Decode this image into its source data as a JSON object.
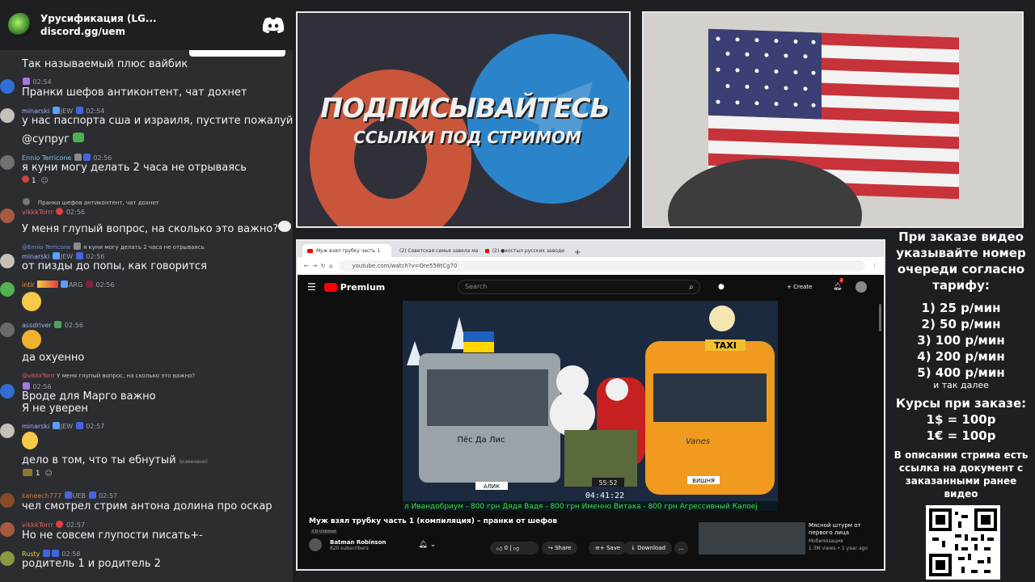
{
  "server": {
    "name": "Урусификация (LG...",
    "invite": "discord.gg/uem"
  },
  "messages": [
    {
      "id": "m1",
      "text": "Так называемый плюс вайбик"
    },
    {
      "id": "m2",
      "time": "02:54",
      "text": "Пранки шефов антиконтент, чат дохнет"
    },
    {
      "id": "m3",
      "user": "minarski",
      "tag": "JEW",
      "time": "02:54",
      "text": "у нас паспорта сша и израиля, пустите пожалуйста",
      "text2": "@супруг"
    },
    {
      "id": "m4",
      "user": "Ennio Terricone",
      "time": "02:56",
      "text": "я куни могу делать 2 часа не отрываясь",
      "reaction_count": "1"
    },
    {
      "id": "m5",
      "reply": "Пранки шефов антиконтент, чат дохнет",
      "user": "vikkkTorrr",
      "time": "02:56",
      "text": "У меня глупый вопрос, на сколько это важно?"
    },
    {
      "id": "m6",
      "reply_user": "@Ennio Terricone",
      "reply": "я куни могу делать 2 часа не отрываясь",
      "user": "minarski",
      "tag": "JEW",
      "time": "02:56",
      "text": "от пизды до попы, как говорится"
    },
    {
      "id": "m7",
      "user": "intir",
      "tag": "ARG",
      "time": "02:56"
    },
    {
      "id": "m8",
      "user": "assdriver",
      "time": "02:56",
      "text": "да охуенно"
    },
    {
      "id": "m9",
      "reply_user": "@vikkkTorrr",
      "reply": "У меня глупый вопрос, на сколько это важно?",
      "time": "02:56",
      "text": "Вроде для Марго важно",
      "text2": "Я не уверен"
    },
    {
      "id": "m10",
      "user": "minarski",
      "tag": "JEW",
      "time": "02:57",
      "text": "дело в том, что ты ебнутый",
      "edited": "(изменено)",
      "reaction_count": "1"
    },
    {
      "id": "m11",
      "user": "kaneech777",
      "tag": "UEB",
      "time": "02:57",
      "text": "чел смотрел стрим антона долина про оскар"
    },
    {
      "id": "m12",
      "user": "vikkkTorrr",
      "time": "02:57",
      "text": "Но не совсем глупости писать+-"
    },
    {
      "id": "m13",
      "user": "Rusty",
      "time": "02:58",
      "text": "родитель 1 и родитель 2"
    }
  ],
  "banner": {
    "title": "ПОДПИСЫВАЙТЕСЬ",
    "subtitle": "ССЫЛКИ ПОД СТРИМОМ"
  },
  "browser": {
    "tabs": [
      {
        "label": "Муж взял трубку часть 1"
      },
      {
        "label": "(2) Советская семья завела ма"
      },
      {
        "label": "(2) ●костыл русских заводи"
      }
    ],
    "url": "youtube.com/watch?v=Ore558tCg70",
    "brand": "Premium",
    "search_placeholder": "Search",
    "create_label": "Create",
    "notif_count": "2",
    "video": {
      "flag_sign": "TAXI",
      "banner_left": "Пёс Да Лис",
      "plate_left": "АЛИК",
      "plate_right": "ВИШНЯ",
      "timer_top": "55:52",
      "timer": "04:41:22",
      "ticker": "л Ивандобриум - 800 грн   Дядя Вадя - 800 грн   Именно Витаха - 800 грн   Агрессивный Калоеj",
      "bus_brand": "Vanes"
    },
    "video_title": "Муж взял трубку часть 1 (компиляция) – пранки от шефов",
    "unlisted": "CD Unlisted",
    "channel": {
      "name": "Batman Robinson",
      "subs": "820 subscribers"
    },
    "actions": {
      "likes": "0",
      "share": "Share",
      "save": "Save",
      "download": "Download"
    },
    "side_video": {
      "title": "Мясной штурм от первого лица",
      "channel": "Мобилизация",
      "views": "1.3M views • 1 year ago"
    }
  },
  "info": {
    "head": "При заказе видео указывайте номер очереди согласно тарифу:",
    "tariffs": [
      "1) 25 р/мин",
      "2) 50 р/мин",
      "3) 100 р/мин",
      "4) 200 р/мин",
      "5) 400 р/мин"
    ],
    "etc": "и так далее",
    "courses_head": "Курсы при заказе:",
    "courses": [
      "1$ = 100р",
      "1€ = 100р"
    ],
    "desc": "В описании стрима есть ссылка на документ с заказанными ранее видео"
  }
}
